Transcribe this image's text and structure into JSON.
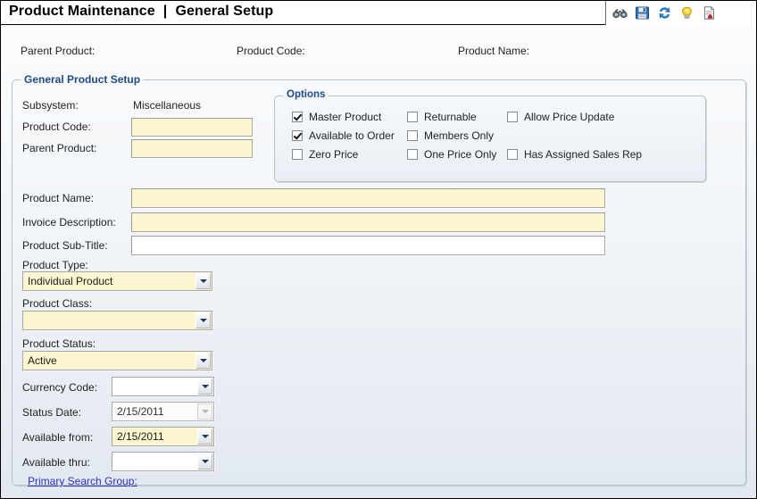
{
  "window": {
    "title": "Product Maintenance  |  General Setup"
  },
  "toolbar": {
    "items": [
      {
        "name": "binoculars-icon",
        "label": "Find"
      },
      {
        "name": "save-icon",
        "label": "Save"
      },
      {
        "name": "refresh-icon",
        "label": "Refresh"
      },
      {
        "name": "lightbulb-icon",
        "label": "Hint"
      },
      {
        "name": "report-icon",
        "label": "Report"
      }
    ]
  },
  "header": {
    "parent_product_label": "Parent Product:",
    "product_code_label": "Product Code:",
    "product_name_label": "Product Name:"
  },
  "general_setup": {
    "legend": "General Product Setup",
    "subsystem_label": "Subsystem:",
    "subsystem_value": "Miscellaneous",
    "product_code_label": "Product Code:",
    "product_code_value": "",
    "parent_product_label": "Parent Product:",
    "parent_product_value": "",
    "product_name_label": "Product Name:",
    "product_name_value": "",
    "invoice_description_label": "Invoice Description:",
    "invoice_description_value": "",
    "product_subtitle_label": "Product Sub-Title:",
    "product_subtitle_value": "",
    "product_type_label": "Product Type:",
    "product_type_value": "Individual Product",
    "product_class_label": "Product Class:",
    "product_class_value": "",
    "product_status_label": "Product Status:",
    "product_status_value": "Active",
    "currency_code_label": "Currency Code:",
    "currency_code_value": "",
    "status_date_label": "Status Date:",
    "status_date_value": "2/15/2011",
    "available_from_label": "Available from:",
    "available_from_value": "2/15/2011",
    "available_thru_label": "Available thru:",
    "available_thru_value": "",
    "primary_search_group_link": "Primary Search Group:"
  },
  "options": {
    "legend": "Options",
    "items": [
      {
        "label": "Master Product",
        "checked": true
      },
      {
        "label": "Available to Order",
        "checked": true
      },
      {
        "label": "Zero Price",
        "checked": false
      },
      {
        "label": "Returnable",
        "checked": false
      },
      {
        "label": "Members Only",
        "checked": false
      },
      {
        "label": "One Price Only",
        "checked": false
      },
      {
        "label": "Allow Price Update",
        "checked": false
      },
      {
        "label": "Has Assigned Sales Rep",
        "checked": false
      }
    ]
  },
  "colors": {
    "required_field": "#fcf6d0",
    "legend_text": "#204a87",
    "link": "#2b30c0",
    "border": "#b9c0c9"
  }
}
